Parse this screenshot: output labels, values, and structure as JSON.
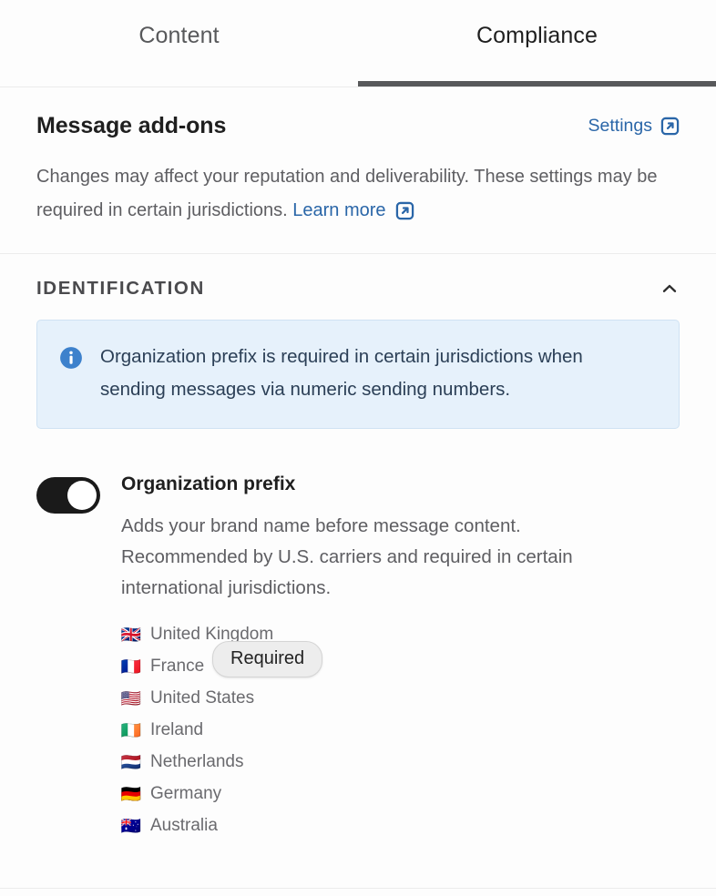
{
  "tabs": [
    {
      "label": "Content",
      "active": false
    },
    {
      "label": "Compliance",
      "active": true
    }
  ],
  "addons": {
    "title": "Message add-ons",
    "settings_link": "Settings",
    "description_part1": "Changes may affect your reputation and deliverability. These settings may be required in certain jurisdictions. ",
    "learn_more_link": "Learn more"
  },
  "identification": {
    "title": "IDENTIFICATION",
    "collapse_icon": "chevron-up-icon",
    "banner": {
      "icon": "info-circle-icon",
      "text": "Organization prefix is required in certain jurisdictions when sending messages via numeric sending numbers."
    },
    "setting": {
      "toggle_state": "on",
      "title": "Organization prefix",
      "description": "Adds your brand name before message content. Recommended by U.S. carriers and required in certain international jurisdictions.",
      "countries": [
        {
          "flag": "🇬🇧",
          "name": "United Kingdom"
        },
        {
          "flag": "🇫🇷",
          "name": "France"
        },
        {
          "flag": "🇺🇸",
          "name": "United States"
        },
        {
          "flag": "🇮🇪",
          "name": "Ireland"
        },
        {
          "flag": "🇳🇱",
          "name": "Netherlands"
        },
        {
          "flag": "🇩🇪",
          "name": "Germany"
        },
        {
          "flag": "🇦🇺",
          "name": "Australia"
        }
      ],
      "tooltip": "Required"
    }
  },
  "colors": {
    "link": "#2a66a8",
    "banner_bg": "#e6f1fb",
    "banner_border": "#cfe2f3",
    "toggle_on": "#1a1a1a",
    "active_tab_underline": "#58595b"
  }
}
